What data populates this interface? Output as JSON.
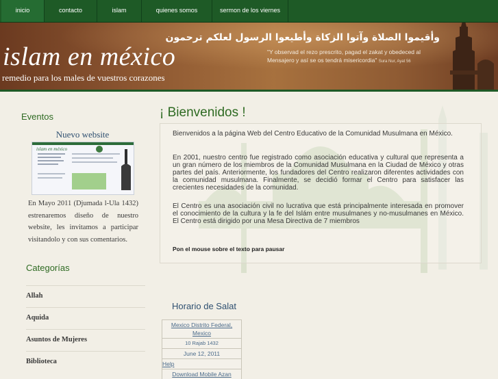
{
  "nav": {
    "items": [
      {
        "label": "inicio",
        "active": true
      },
      {
        "label": "contacto"
      },
      {
        "label": "islam"
      },
      {
        "label": "quienes somos"
      },
      {
        "label": "sermon de los viernes"
      }
    ]
  },
  "header": {
    "title": "islam en méxico",
    "subtitle": "remedio para los males de vuestros corazones",
    "arabic": "وأقيموا الصلاة وآتوا الزكاة وأطيعوا الرسول لعلكم ترحمون",
    "quote": "\"Y observad el rezo prescrito, pagad el zakat y obedeced al Mensajero y así se os tendrá misericordia\"",
    "quote_source": "Sura Nur, Ayat 56"
  },
  "sidebar": {
    "events_title": "Eventos",
    "news_title": "Nuevo website",
    "news_text": "En Mayo 2011 (Djumada l-Ula 1432) estrenaremos diseño de nuestro website, les invitamos a participar visitandolo y con sus comentarios.",
    "thumb_title": "islam en méxico",
    "categories_title": "Categorías",
    "categories": [
      "Allah",
      "Aquida",
      "Asuntos de Mujeres",
      "Biblioteca"
    ]
  },
  "main": {
    "welcome_title": "¡ Bienvenidos !",
    "paragraphs": [
      "Bienvenidos a la página Web del Centro Educativo de la Comunidad Musulmana en México.",
      "En 2001, nuestro centro fue registrado como asociación educativa y cultural que representa a un gran número de los miembros de la Comunidad Musulmana en la Ciudad de México y otras partes del país. Anteriormente, los fundadores del Centro realizaron diferentes actividades con la comunidad musulmana. Finalmente, se decidió formar el Centro para satisfacer las crecientes necesidades de la comunidad.",
      "El Centro es una asociación civil no lucrativa que está principalmente interesada en promover el conocimiento de la cultura y la fe del Islám entre musulmanes y no-musulmanes en México. El Centro está dirigido por una Mesa Directiva de 7 miembros"
    ],
    "hover_hint": "Pon el mouse sobre el texto para pausar",
    "salat_title": "Horario de Salat",
    "salat": {
      "location_city": "Mexico Distrito Federal,",
      "location_country": "Mexico",
      "hijri_date": "10 Rajab 1432",
      "date": "June 12, 2011",
      "help": "Help",
      "download": "Download Mobile Azan"
    }
  },
  "colors": {
    "nav_bg": "#1e5a26",
    "heading_green": "#2e6a22",
    "link_blue": "#2e4f70",
    "header_brown": "#8a5430"
  }
}
